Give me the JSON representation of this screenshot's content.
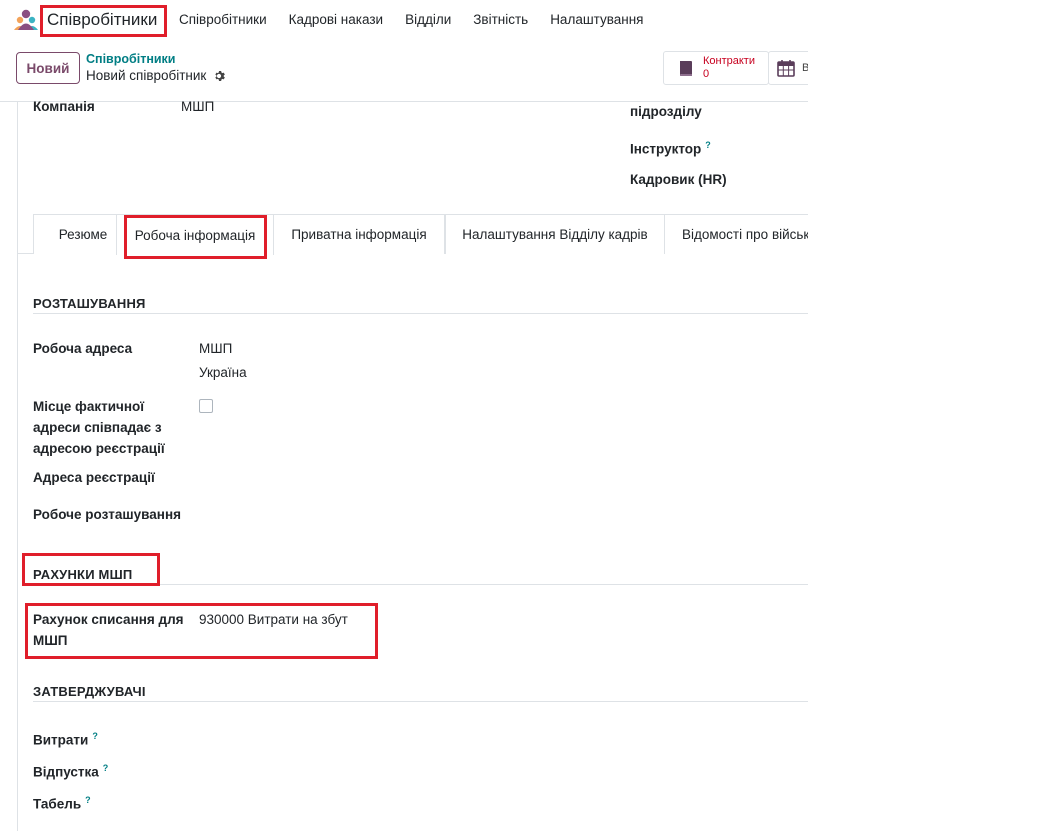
{
  "navbar": {
    "app_name": "Співробітники",
    "menu": [
      "Співробітники",
      "Кадрові накази",
      "Відділи",
      "Звітність",
      "Налаштування"
    ]
  },
  "control_panel": {
    "new_button": "Новий",
    "breadcrumb": "Співробітники",
    "record_name": "Новий співробітник",
    "stat_contracts_label": "Контракти",
    "stat_contracts_count": "0",
    "stat_second_label": "В"
  },
  "header_fields": {
    "company_label": "Компанія",
    "company_value": "МШП",
    "department_suffix_label": "підрозділу",
    "instructor_label": "Інструктор",
    "hr_label": "Кадровик (HR)",
    "help_mark": "?"
  },
  "tabs": [
    "Резюме",
    "Робоча інформація",
    "Приватна інформація",
    "Налаштування Відділу кадрів",
    "Відомості про військ"
  ],
  "location": {
    "title": "РОЗТАШУВАННЯ",
    "work_address_label": "Робоча адреса",
    "work_address_line1": "МШП",
    "work_address_line2": "Україна",
    "same_address_label_1": "Місце фактичної",
    "same_address_label_2": "адреси співпадає з",
    "same_address_label_3": "адресою реєстрації",
    "registration_address_label": "Адреса реєстрації",
    "work_location_label": "Робоче розташування"
  },
  "accounts": {
    "title": "РАХУНКИ МШП",
    "writeoff_label_1": "Рахунок списання для",
    "writeoff_label_2": "МШП",
    "writeoff_value": "930000 Витрати на збут"
  },
  "approvers": {
    "title": "ЗАТВЕРДЖУВАЧІ",
    "expenses_label": "Витрати",
    "timeoff_label": "Відпустка",
    "timesheet_label": "Табель"
  }
}
